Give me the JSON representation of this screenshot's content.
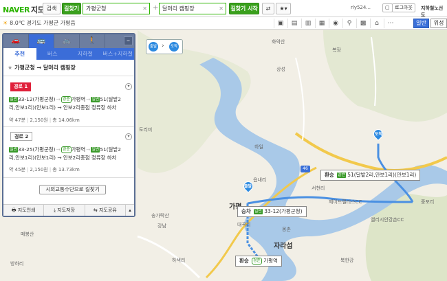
{
  "topbar": {
    "logo_brand": "NAVER",
    "logo_map": "지도",
    "search_button": "검색",
    "route_tab": "길찾기",
    "origin_value": "가평군청",
    "destination_value": "달머리 캠핑장",
    "route_start_button": "길찾기 시작",
    "username": "rly524...",
    "logout_button": "로그아웃",
    "subway_link": "지하철노선도"
  },
  "bar2": {
    "weather_text": "8.0℃ 경기도 가평군 가평읍",
    "view_normal": "일반",
    "view_satellite": "위성"
  },
  "panel": {
    "modes": [
      "car",
      "bus",
      "bike",
      "walk"
    ],
    "tabs": [
      "추천",
      "버스",
      "지하철",
      "버스+지하철"
    ],
    "route_title": "가평군청 → 달머리 캠핑장",
    "routes": [
      {
        "badge": "경로 1",
        "line1_a": "33-12(가평군청)",
        "line1_b": "가평역",
        "line1_c": "51(달밭2",
        "line2": "리,안보1리)(안보1리) → 안보2리종점 정류장 하차",
        "time": "약 47분",
        "fare": "2,150원",
        "dist": "총 14.06km"
      },
      {
        "badge": "경로 2",
        "line1_a": "33-25(가평군청)",
        "line1_b": "가평역",
        "line1_c": "51(달밭2",
        "line2": "리,안보1리)(안보1리) → 안보2리종점 정류장 하차",
        "time": "약 45분",
        "fare": "2,150원",
        "dist": "총 13.73km"
      }
    ],
    "tag_bus": "일반",
    "tag_rail": "경춘",
    "other_button": "시외교통수단으로 길찾기",
    "footer": [
      "지도인쇄",
      "지도저장",
      "지도공유"
    ]
  },
  "map": {
    "start_label": "출발",
    "dest_label": "도착",
    "labels": {
      "gapyeong": "가평",
      "bokjang": "복장",
      "sangseong": "상성",
      "seocheon": "서천리",
      "hail": "하일",
      "mongchon": "몽촌",
      "songgarak": "송가락산",
      "gangnam": "강남",
      "daegokri": "대곡리",
      "ilpuho": "읍내리",
      "hasaekri": "하색리",
      "dorim": "도리미",
      "bukhan": "북한강",
      "jaraseom": "자라섬",
      "ellisian": "엘리시안강촌CC",
      "maebongsan": "매봉산",
      "hwaaksan": "화악산",
      "jeilCC": "제이드팰리스CC",
      "jungpo": "중포리",
      "bangha": "방하리"
    },
    "callouts": {
      "transfer1_kind": "환승",
      "transfer1_text": "51(달밭2리,안보1리)(안보1리)",
      "board_kind": "승차",
      "board_text": "33-12(가평군청)",
      "transfer2_kind": "환승",
      "transfer2_text": "가평역"
    },
    "road_number": "46"
  }
}
